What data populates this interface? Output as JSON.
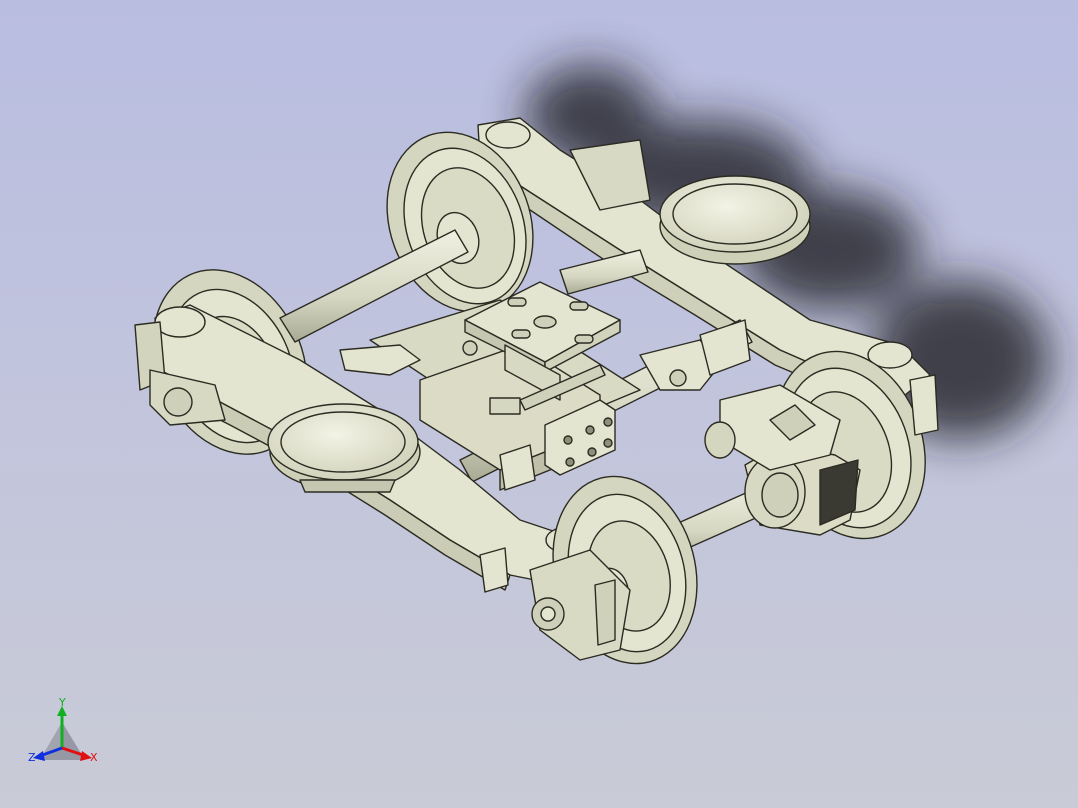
{
  "viewport": {
    "background_top": "#b9bde0",
    "background_bottom": "#c9cbd6",
    "model_color": "#e4e5d0",
    "edge_color": "#2b2b22",
    "shadow_color": "#1c1c24"
  },
  "triad": {
    "x_label": "X",
    "y_label": "Y",
    "z_label": "Z",
    "x_color": "#e01010",
    "y_color": "#10b020",
    "z_color": "#1030e0"
  }
}
